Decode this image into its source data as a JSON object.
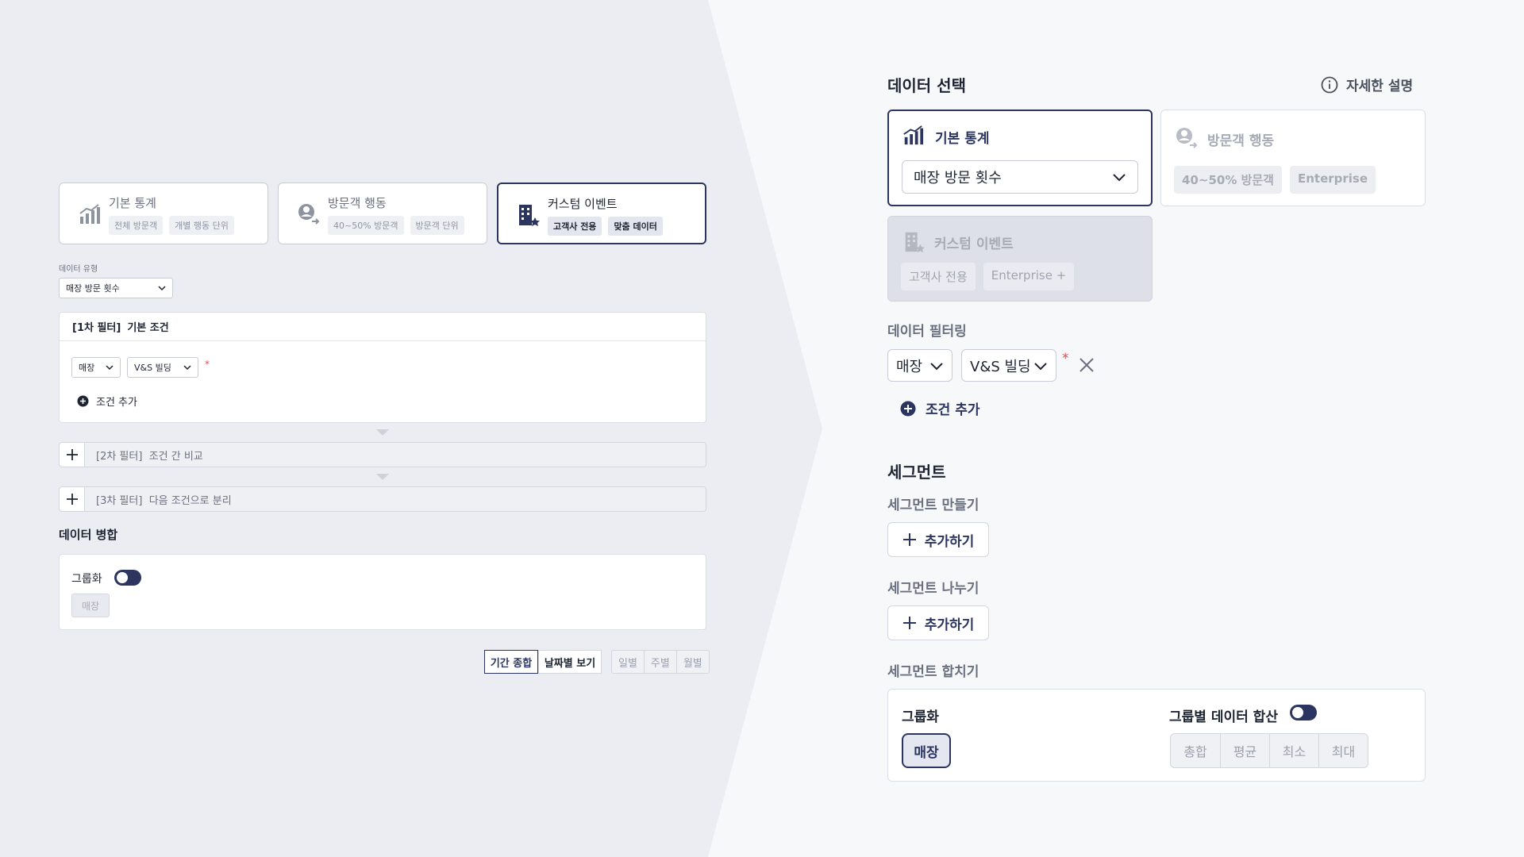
{
  "left": {
    "cards": [
      {
        "title": "기본 통계",
        "tags": [
          "전체 방문객",
          "개별 행동 단위"
        ]
      },
      {
        "title": "방문객 행동",
        "tags": [
          "40~50% 방문객",
          "방문객 단위"
        ]
      },
      {
        "title": "커스텀 이벤트",
        "tags": [
          "고객사 전용",
          "맞춤 데이터"
        ]
      }
    ],
    "data_type_label": "데이터 유형",
    "data_type_value": "매장 방문 횟수",
    "filter1": {
      "prefix": "[1차 필터]",
      "title": "기본 조건",
      "select1": "매장",
      "select2": "V&S 빌딩",
      "required": "*",
      "add_condition": "조건 추가"
    },
    "filter2": {
      "prefix": "[2차 필터]",
      "title": "조건 간 비교"
    },
    "filter3": {
      "prefix": "[3차 필터]",
      "title": "다음 조건으로 분리"
    },
    "merge_title": "데이터 병합",
    "grouping_label": "그룹화",
    "grouping_chip": "매장",
    "view_buttons": [
      "기간 종합",
      "날짜별 보기"
    ],
    "period_buttons": [
      "일별",
      "주별",
      "월별"
    ]
  },
  "right": {
    "title": "데이터 선택",
    "help": "자세한 설명",
    "basic": {
      "title": "기본 통계",
      "select": "매장 방문 횟수"
    },
    "visitor": {
      "title": "방문객 행동",
      "tags": [
        "40~50% 방문객",
        "Enterprise"
      ]
    },
    "custom": {
      "title": "커스텀 이벤트",
      "tags": [
        "고객사 전용",
        "Enterprise +"
      ]
    },
    "filtering_title": "데이터 필터링",
    "filter_select1": "매장",
    "filter_select2": "V&S 빌딩",
    "required": "*",
    "add_condition": "조건 추가",
    "segment_title": "세그먼트",
    "segment_create": "세그먼트 만들기",
    "segment_split": "세그먼트 나누기",
    "segment_merge": "세그먼트 합치기",
    "add_label": "추가하기",
    "grouping_label": "그룹화",
    "grouping_chip": "매장",
    "group_sum_label": "그룹별 데이터 합산",
    "agg_buttons": [
      "총합",
      "평균",
      "최소",
      "최대"
    ]
  },
  "colors": {
    "accent": "#2b3560",
    "required": "#e5484d"
  }
}
